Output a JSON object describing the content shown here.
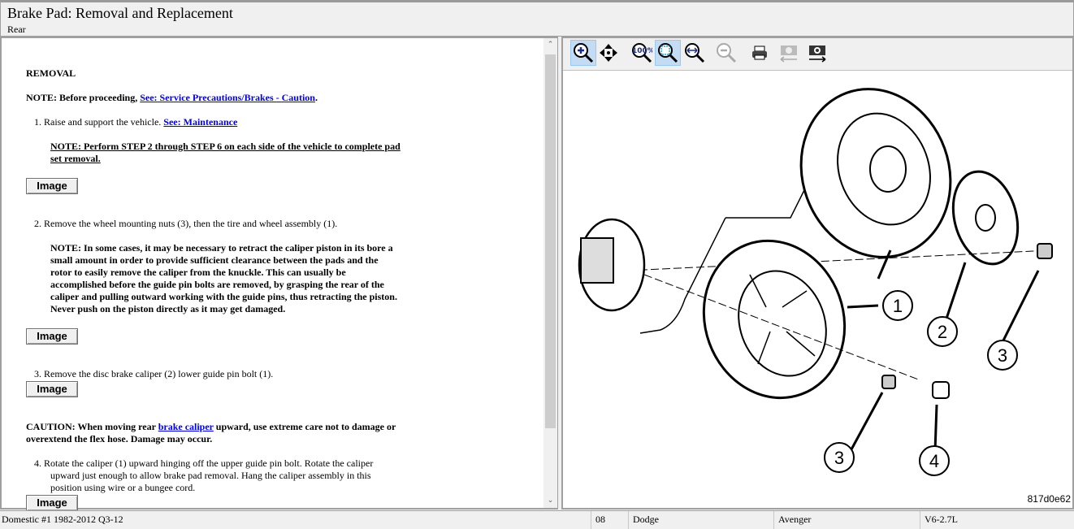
{
  "header": {
    "title": "Brake Pad:  Removal and Replacement",
    "subtitle": "Rear"
  },
  "content": {
    "heading": "REMOVAL",
    "note1_prefix": "NOTE: Before proceeding, ",
    "note1_link": "See: Service Precautions/Brakes - Caution",
    "note1_suffix": ".",
    "step1_text": "1.  Raise and support the vehicle. ",
    "step1_link": "See: Maintenance",
    "step1_note_l1": "NOTE: Perform STEP 2 through STEP 6 on each side of the vehicle to complete pad",
    "step1_note_l2": "set removal.",
    "image_label": "Image",
    "step2_text": "2.  Remove the wheel mounting nuts (3), then the tire and wheel assembly (1).",
    "step2_note": [
      "NOTE: In some cases, it may be necessary to retract the caliper piston in its bore a",
      "small amount in order to provide sufficient clearance between the pads and the",
      "rotor to easily remove the caliper from the knuckle. This can usually be",
      "accomplished before the guide pin bolts are removed, by grasping the rear of the",
      "caliper and pulling outward working with the guide pins, thus retracting the piston.",
      "Never push on the piston directly as it may get damaged."
    ],
    "step3_text": "3.  Remove the disc brake caliper (2) lower guide pin bolt (1).",
    "caution_prefix": "CAUTION: When moving rear ",
    "caution_link": "brake caliper",
    "caution_suffix": " upward, use extreme care not to damage or",
    "caution_l2": "overextend the flex hose. Damage may occur.",
    "step4": [
      "4.  Rotate the caliper (1) upward hinging off the upper guide pin bolt. Rotate the caliper",
      "upward just enough to allow brake pad removal. Hang the caliper assembly in this",
      "position using wire or a bungee cord."
    ]
  },
  "toolbar": {
    "tools": [
      "zoom-in",
      "pan",
      "zoom-100",
      "zoom-fit",
      "zoom-width",
      "zoom-out",
      "print",
      "previous-image",
      "next-image"
    ]
  },
  "diagram": {
    "callouts": [
      "1",
      "2",
      "3",
      "3",
      "4"
    ],
    "code": "817d0e62"
  },
  "status": {
    "source": "Domestic #1 1982-2012 Q3-12",
    "year": "08",
    "make": "Dodge",
    "model": "Avenger",
    "engine": "V6-2.7L"
  }
}
